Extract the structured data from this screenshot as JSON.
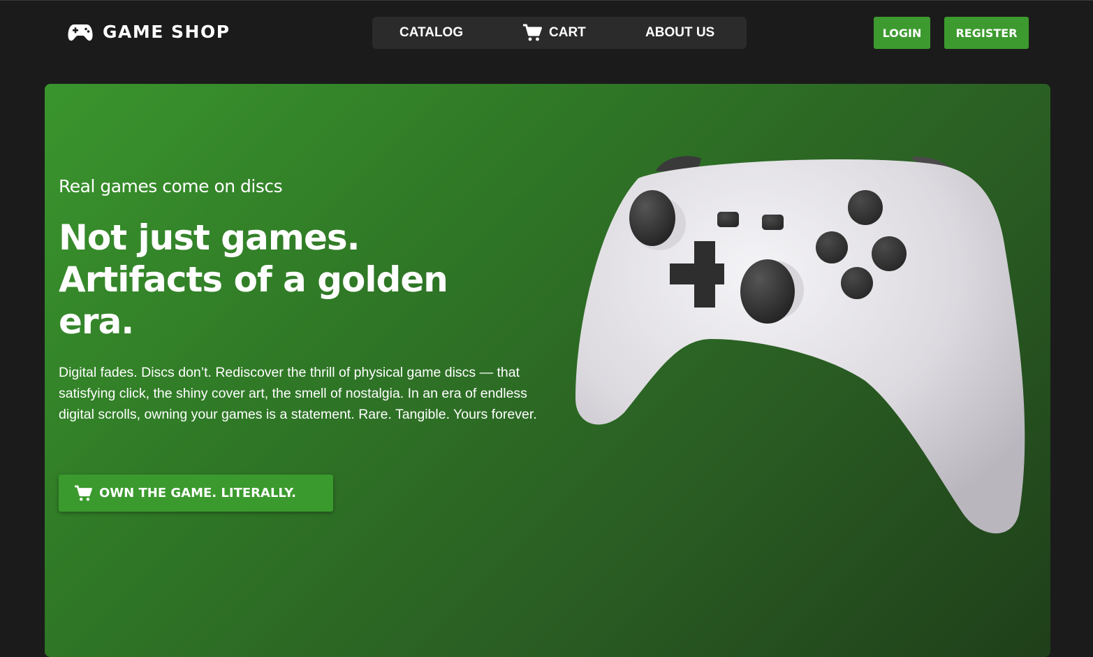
{
  "brand": {
    "name": "GAME SHOP",
    "icon": "gamepad-icon"
  },
  "nav": {
    "items": [
      {
        "label": "CATALOG"
      },
      {
        "label": "CART",
        "icon": "cart-icon"
      },
      {
        "label": "ABOUT US"
      }
    ]
  },
  "auth": {
    "login_label": "LOGIN",
    "register_label": "REGISTER"
  },
  "hero": {
    "tagline": "Real games come on discs",
    "headline": "Not just games. Artifacts of a golden era.",
    "description": "Digital fades. Discs don’t. Rediscover the thrill of physical game discs — that satisfying click, the shiny cover art, the smell of nostalgia. In an era of endless digital scrolls, owning your games is a statement. Rare. Tangible. Yours forever.",
    "cta_label": "OWN THE GAME. LITERALLY.",
    "cta_icon": "cart-icon",
    "image": "white-game-controller"
  },
  "colors": {
    "page_background": "#1b1b1b",
    "nav_background": "#2b2b2b",
    "accent_green": "#3d9a2f",
    "hero_gradient_start": "#3a952d",
    "hero_gradient_end": "#1f3f1a"
  }
}
